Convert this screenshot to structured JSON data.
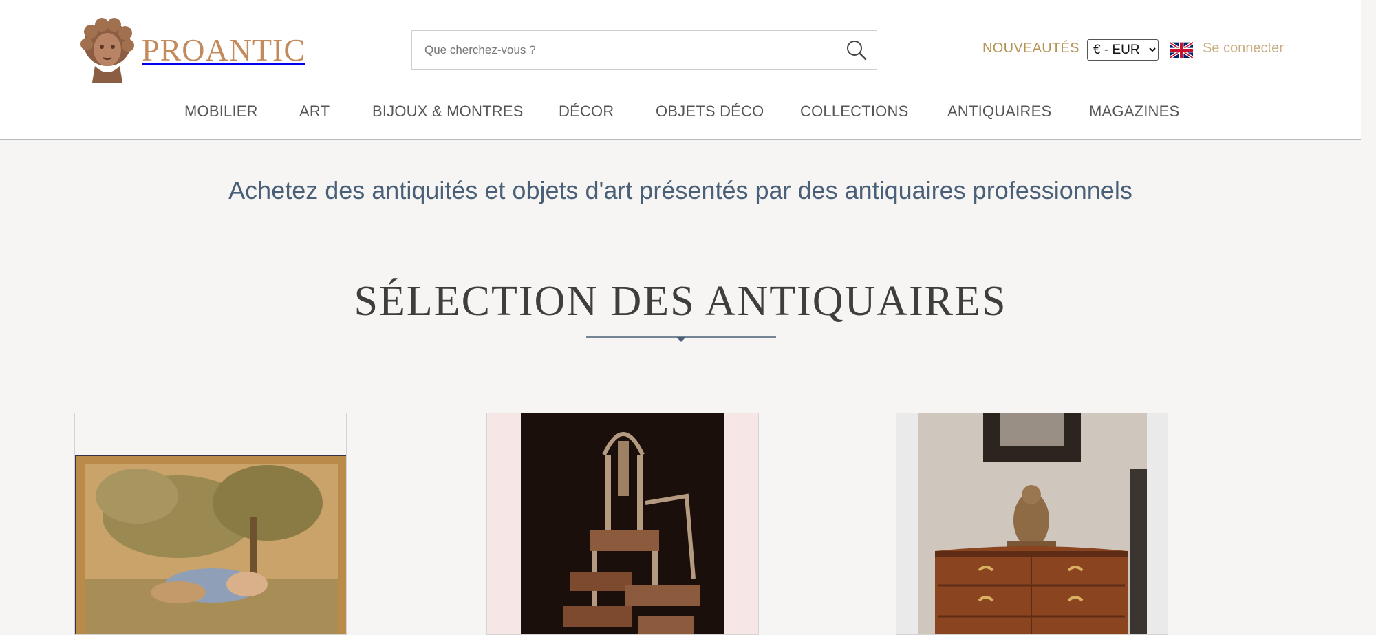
{
  "header": {
    "logo_text": "PROANTIC",
    "search_placeholder": "Que cherchez-vous ?",
    "nouveautes_label": "NOUVEAUTÉS",
    "currency": {
      "selected": "€ - EUR",
      "options": [
        "€ - EUR"
      ]
    },
    "login_label": "Se connecter"
  },
  "nav": {
    "items": [
      {
        "label": "MOBILIER"
      },
      {
        "label": "ART"
      },
      {
        "label": "BIJOUX & MONTRES"
      },
      {
        "label": "DÉCOR"
      },
      {
        "label": "OBJETS DÉCO"
      },
      {
        "label": "COLLECTIONS"
      },
      {
        "label": "ANTIQUAIRES"
      },
      {
        "label": "MAGAZINES"
      }
    ]
  },
  "main": {
    "tagline": "Achetez des antiquités et objets d'art présentés par des antiquaires professionnels",
    "section_title": "SÉLECTION DES ANTIQUAIRES",
    "products": [
      {
        "image": "tapestry-pastoral-scene"
      },
      {
        "image": "stacked-chairs"
      },
      {
        "image": "marquetry-commode-with-cherub"
      }
    ]
  },
  "colors": {
    "accent_gold": "#b59356",
    "logo_copper": "#c28a5d",
    "tagline_blue": "#4a6078",
    "page_background": "#f6f5f3"
  },
  "icons": [
    "logo-bust-icon",
    "search-icon",
    "uk-flag-icon"
  ]
}
